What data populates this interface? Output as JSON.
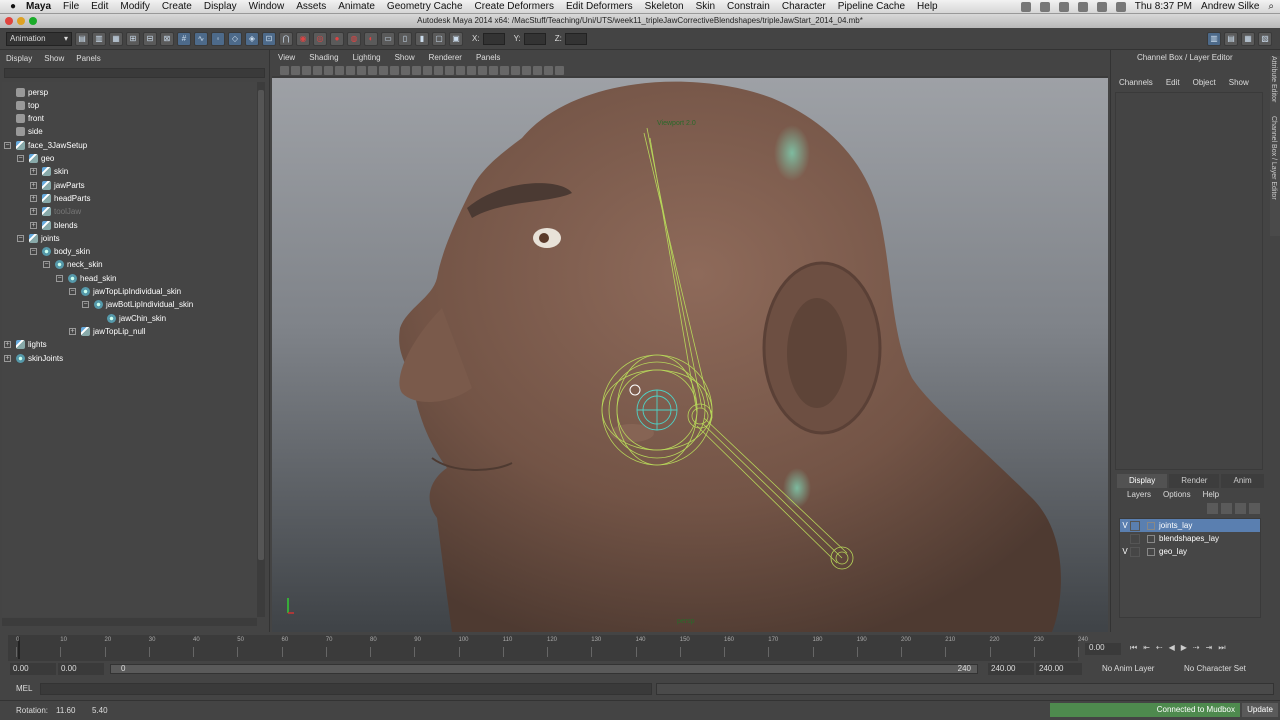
{
  "mac_menubar": {
    "app_name": "Maya",
    "items": [
      "File",
      "Edit",
      "Modify",
      "Create",
      "Display",
      "Window",
      "Assets",
      "Animate",
      "Geometry Cache",
      "Create Deformers",
      "Edit Deformers",
      "Skeleton",
      "Skin",
      "Constrain",
      "Character",
      "Pipeline Cache",
      "Help"
    ],
    "clock": "Thu 8:37 PM",
    "user": "Andrew Silke"
  },
  "window": {
    "title": "Autodesk Maya 2014 x64: /MacStuff/Teaching/Uni/UTS/week11_tripleJawCorrectiveBlendshapes/tripleJawStart_2014_04.mb*"
  },
  "status_line": {
    "mode": "Animation",
    "x_label": "X:",
    "y_label": "Y:",
    "z_label": "Z:"
  },
  "outliner": {
    "menu": [
      "Display",
      "Show",
      "Panels"
    ],
    "nodes": [
      {
        "label": "persp",
        "type": "camera",
        "indent": 0,
        "expander": ""
      },
      {
        "label": "top",
        "type": "camera",
        "indent": 0,
        "expander": ""
      },
      {
        "label": "front",
        "type": "camera",
        "indent": 0,
        "expander": ""
      },
      {
        "label": "side",
        "type": "camera",
        "indent": 0,
        "expander": ""
      },
      {
        "label": "face_3JawSetup",
        "type": "transform",
        "indent": 0,
        "expander": "−"
      },
      {
        "label": "geo",
        "type": "transform",
        "indent": 1,
        "expander": "−"
      },
      {
        "label": "skin",
        "type": "transform",
        "indent": 2,
        "expander": "+"
      },
      {
        "label": "jawParts",
        "type": "transform",
        "indent": 2,
        "expander": "+"
      },
      {
        "label": "headParts",
        "type": "transform",
        "indent": 2,
        "expander": "+"
      },
      {
        "label": "toolJaw",
        "type": "transform",
        "indent": 2,
        "expander": "+",
        "hidden": true
      },
      {
        "label": "blends",
        "type": "transform",
        "indent": 2,
        "expander": "+"
      },
      {
        "label": "joints",
        "type": "transform",
        "indent": 1,
        "expander": "−"
      },
      {
        "label": "body_skin",
        "type": "joint",
        "indent": 2,
        "expander": "−"
      },
      {
        "label": "neck_skin",
        "type": "joint",
        "indent": 3,
        "expander": "−"
      },
      {
        "label": "head_skin",
        "type": "joint",
        "indent": 4,
        "expander": "−"
      },
      {
        "label": "jawTopLipIndividual_skin",
        "type": "joint",
        "indent": 5,
        "expander": "−"
      },
      {
        "label": "jawBotLipIndividual_skin",
        "type": "joint",
        "indent": 6,
        "expander": "−"
      },
      {
        "label": "jawChin_skin",
        "type": "joint",
        "indent": 7,
        "expander": ""
      },
      {
        "label": "jawTopLip_null",
        "type": "transform",
        "indent": 5,
        "expander": "+"
      },
      {
        "label": "lights",
        "type": "transform",
        "indent": 0,
        "expander": "+"
      },
      {
        "label": "skinJoints",
        "type": "joint",
        "indent": 0,
        "expander": "+"
      }
    ]
  },
  "viewport": {
    "menu": [
      "View",
      "Shading",
      "Lighting",
      "Show",
      "Renderer",
      "Panels"
    ],
    "camera_label": "persp",
    "hud_top": "Viewport 2.0"
  },
  "channel_box": {
    "title": "Channel Box / Layer Editor",
    "menu": [
      "Channels",
      "Edit",
      "Object",
      "Show"
    ],
    "side_tabs": [
      "Attribute Editor",
      "Channel Box / Layer Editor"
    ],
    "layer_tabs": [
      "Display",
      "Render",
      "Anim"
    ],
    "layer_menu": [
      "Layers",
      "Options",
      "Help"
    ],
    "layers": [
      {
        "name": "joints_lay",
        "visible": "V",
        "selected": true
      },
      {
        "name": "blendshapes_lay",
        "visible": "",
        "selected": false
      },
      {
        "name": "geo_lay",
        "visible": "V",
        "selected": false
      }
    ]
  },
  "timeline": {
    "ticks": [
      "0",
      "10",
      "20",
      "30",
      "40",
      "50",
      "60",
      "70",
      "80",
      "90",
      "100",
      "110",
      "120",
      "130",
      "140",
      "150",
      "160",
      "170",
      "180",
      "190",
      "200",
      "210",
      "220",
      "230",
      "240"
    ],
    "current_frame": "0.00"
  },
  "range_slider": {
    "start": "0.00",
    "playback_start": "0.00",
    "inner_start": "0",
    "inner_end": "240",
    "playback_end": "240.00",
    "end": "240.00",
    "anim_layer": "No Anim Layer",
    "character_set": "No Character Set"
  },
  "command_line": {
    "label": "MEL"
  },
  "help_line": {
    "rotation_label": "Rotation:",
    "rotation_x": "11.60",
    "rotation_y": "5.40",
    "mudbox_status": "Connected to Mudbox",
    "update_label": "Update"
  },
  "colors": {
    "accent": "#5a7fb0",
    "mudbox": "#4e8a4e",
    "skin": "#7a5b4c",
    "joint_wire": "#b7d65a"
  }
}
